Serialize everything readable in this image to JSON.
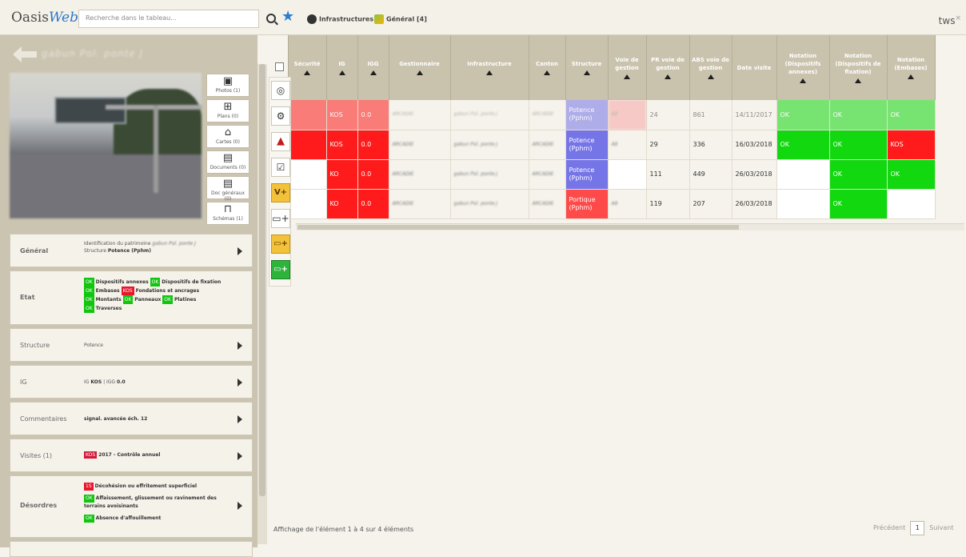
{
  "app": {
    "name_part1": "Oasis",
    "name_part2": "Web",
    "user": "tws"
  },
  "search": {
    "placeholder": "Recherche dans le tableau..."
  },
  "breadcrumbs": [
    {
      "label": "Infrastructures",
      "icon": "camera-icon"
    },
    {
      "label": "Général [4]",
      "icon": "map-icon"
    }
  ],
  "left_panel": {
    "title_blurred": "gabun Pol. ponte J",
    "media_buttons": [
      {
        "label": "Photos (1)",
        "icon": "photo-icon"
      },
      {
        "label": "Plans (0)",
        "icon": "plan-icon"
      },
      {
        "label": "Cartes (0)",
        "icon": "map-icon"
      },
      {
        "label": "Documents (0)",
        "icon": "document-icon"
      },
      {
        "label": "Doc généraux (0)",
        "icon": "document-icon"
      },
      {
        "label": "Schémas (1)",
        "icon": "schema-icon"
      }
    ],
    "general": {
      "label": "Général",
      "line1_label": "Identification du patrimoine",
      "line1_value": "gabun Pol. ponte J",
      "line2_label": "Structure",
      "line2_value": "Potence (Pphm)"
    },
    "etat": {
      "label": "Etat",
      "items": [
        {
          "status": "OK",
          "text": "Dispositifs annexes"
        },
        {
          "status": "OK",
          "text": "Dispositifs de fixation"
        },
        {
          "status": "OK",
          "text": "Embases"
        },
        {
          "status": "KOS",
          "text": "Fondations et ancrages"
        },
        {
          "status": "OK",
          "text": "Montants"
        },
        {
          "status": "OK",
          "text": "Panneaux"
        },
        {
          "status": "OK",
          "text": "Platines"
        },
        {
          "status": "OK",
          "text": "Traverses"
        }
      ]
    },
    "structure": {
      "label": "Structure",
      "value": "Potence"
    },
    "ig": {
      "label": "IG",
      "ig_label": "IG",
      "ig_value": "KOS",
      "igg_label": "IGG",
      "igg_value": "0.0"
    },
    "commentaires": {
      "label": "Commentaires",
      "value": "signal. avancée éch. 12"
    },
    "visites": {
      "label": "Visites (1)",
      "status": "KOS",
      "value": "2017 - Contrôle annuel"
    },
    "desordres": {
      "label": "Désordres",
      "items": [
        {
          "status": "1S",
          "text": "Décohésion ou effritement superficiel"
        },
        {
          "status": "OK",
          "text": "Affaissement, glissement ou ravinement des terrains avoisinants"
        },
        {
          "status": "OK",
          "text": "Absence d'affouillement"
        }
      ]
    }
  },
  "table": {
    "columns": [
      "Sécurité",
      "IG",
      "IGG",
      "Gestionnaire",
      "Infrastructure",
      "Canton",
      "Structure",
      "Voie de gestion",
      "PR voie de gestion",
      "ABS voie de gestion",
      "Date visite",
      "Notation (Dispositifs annexes)",
      "Notation (Dispositifs de fixation)",
      "Notation (Embases)"
    ],
    "rows": [
      {
        "ig": "KOS",
        "igg": "0.0",
        "gest": "ARCADIE",
        "infra": "gabun Pol. ponte J",
        "canton": "ARCADIE",
        "structure": "Potence (Pphm)",
        "voie": "A8",
        "pr": "24",
        "abs": "861",
        "date": "14/11/2017",
        "n1": "OK",
        "n2": "OK",
        "n3": "OK"
      },
      {
        "ig": "KOS",
        "igg": "0.0",
        "gest": "ARCADIE",
        "infra": "gabun Pol. ponte J",
        "canton": "ARCADIE",
        "structure": "Potence (Pphm)",
        "voie": "A8",
        "pr": "29",
        "abs": "336",
        "date": "16/03/2018",
        "n1": "OK",
        "n2": "OK",
        "n3": "KOS"
      },
      {
        "ig": "KO",
        "igg": "0.0",
        "gest": "ARCADIE",
        "infra": "gabun Pol. ponte J",
        "canton": "ARCADIE",
        "structure": "Potence (Pphm)",
        "voie": "",
        "pr": "111",
        "abs": "449",
        "date": "26/03/2018",
        "n1": "",
        "n2": "OK",
        "n3": "OK"
      },
      {
        "ig": "KO",
        "igg": "0.0",
        "gest": "ARCADIE",
        "infra": "gabun Pol. ponte J",
        "canton": "ARCADIE",
        "structure": "Portique (Pphm)",
        "voie": "A8",
        "pr": "119",
        "abs": "207",
        "date": "26/03/2018",
        "n1": "",
        "n2": "OK",
        "n3": ""
      }
    ],
    "footer_info": "Affichage de l'élément 1 à 4 sur 4 éléments",
    "pager": {
      "prev": "Précédent",
      "page": "1",
      "next": "Suivant"
    }
  },
  "colors": {
    "accent": "#2a76c8",
    "ok": "#11d80f",
    "kos": "#ff1b1b",
    "header": "#c9c2ad"
  }
}
